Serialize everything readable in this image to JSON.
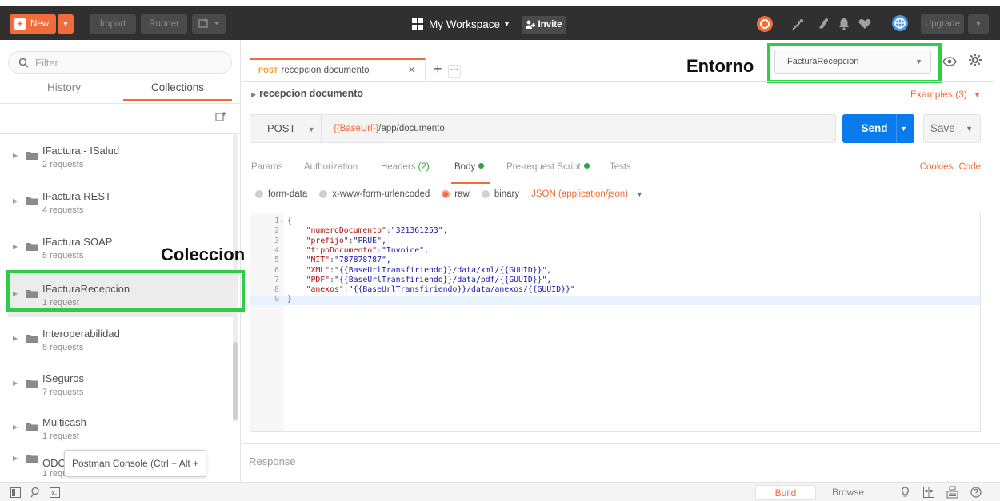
{
  "topbar": {
    "new_label": "New",
    "import_label": "Import",
    "runner_label": "Runner",
    "workspace_label": "My Workspace",
    "invite_label": "Invite",
    "upgrade_label": "Upgrade"
  },
  "sidebar": {
    "filter_placeholder": "Filter",
    "tabs": [
      "History",
      "Collections"
    ],
    "collections": [
      {
        "name": "IFactura - ISalud",
        "requests": "2 requests"
      },
      {
        "name": "IFactura REST",
        "requests": "4 requests"
      },
      {
        "name": "IFactura SOAP",
        "requests": "5 requests"
      },
      {
        "name": "IFacturaRecepcion",
        "requests": "1 request"
      },
      {
        "name": "Interoperabilidad",
        "requests": "5 requests"
      },
      {
        "name": "ISeguros",
        "requests": "7 requests"
      },
      {
        "name": "Multicash",
        "requests": "1 request"
      },
      {
        "name": "ODO",
        "requests": "1 requ"
      }
    ],
    "tooltip": "Postman Console (Ctrl + Alt + C)"
  },
  "annotations": {
    "entorno": "Entorno",
    "coleccion": "Coleccion"
  },
  "request": {
    "tab_method": "POST",
    "tab_name": "recepcion documento",
    "breadcrumb": "recepcion documento",
    "examples": "Examples (3)",
    "method": "POST",
    "url_var": "{{BaseUrl}}",
    "url_path": "/app/documento",
    "send_label": "Send",
    "save_label": "Save",
    "environment": "IFacturaRecepcion"
  },
  "subtabs": {
    "params": "Params",
    "authorization": "Authorization",
    "headers": "Headers",
    "headers_count": "(2)",
    "body": "Body",
    "prerequest": "Pre-request Script",
    "tests": "Tests",
    "cookies": "Cookies",
    "code": "Code"
  },
  "body_types": {
    "form_data": "form-data",
    "urlencoded": "x-www-form-urlencoded",
    "raw": "raw",
    "binary": "binary",
    "json": "JSON (application/json)"
  },
  "editor_lines": [
    {
      "n": "1",
      "k": "",
      "v": "{"
    },
    {
      "n": "2",
      "k": "\"numeroDocumento\"",
      "v": "\"321361253\","
    },
    {
      "n": "3",
      "k": "\"prefijo\"",
      "v": "\"PRUE\","
    },
    {
      "n": "4",
      "k": "\"tipoDocumento\"",
      "v": "\"Invoice\","
    },
    {
      "n": "5",
      "k": "\"NIT\"",
      "v": "\"787878787\","
    },
    {
      "n": "6",
      "k": "\"XML\"",
      "v": "\"{{BaseUrlTransfiriendo}}/data/xml/{{GUUID}}\","
    },
    {
      "n": "7",
      "k": "\"PDF\"",
      "v": "\"{{BaseUrlTransfiriendo}}/data/pdf/{{GUUID}}\","
    },
    {
      "n": "8",
      "k": "\"anexos\"",
      "v": "\"{{BaseUrlTransfiriendo}}/data/anexos/{{GUUID}}\""
    },
    {
      "n": "9",
      "k": "",
      "v": "}"
    }
  ],
  "response_label": "Response",
  "bottombar": {
    "build": "Build",
    "browse": "Browse"
  }
}
